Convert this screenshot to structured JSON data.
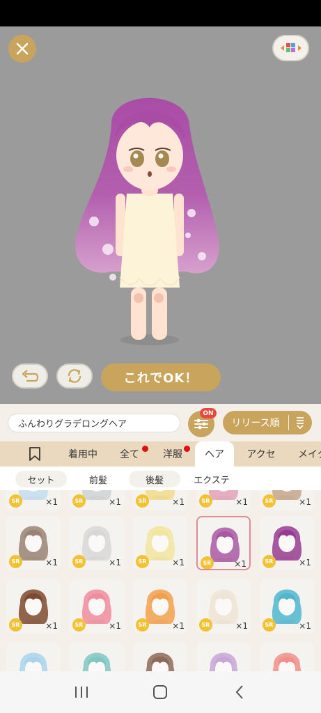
{
  "colors": {
    "accent": "#c9a45c",
    "stage_bg": "#9b9b9b",
    "panel_bg": "#f4efe8",
    "tab_bar": "#ead9bf",
    "badge_red": "#e74a3c"
  },
  "stage": {
    "close_icon": "close-icon",
    "swatch_icon": "color-palette-icon",
    "undo_icon": "undo-icon",
    "refresh_icon": "refresh-icon",
    "ok_label": "これでOK！"
  },
  "panel": {
    "item_name": "ふんわりグラデロングヘア",
    "filter_badge": "ON",
    "sort_label": "リリース順"
  },
  "tabs": [
    {
      "label": "",
      "icon": "bookmark-icon"
    },
    {
      "label": "着用中"
    },
    {
      "label": "全て",
      "dot": true
    },
    {
      "label": "洋服",
      "dot": true
    },
    {
      "label": "ヘア",
      "active": true
    },
    {
      "label": "アクセ"
    },
    {
      "label": "メイク"
    }
  ],
  "subtabs": [
    {
      "label": "セット"
    },
    {
      "label": "前髪"
    },
    {
      "label": "後髪"
    },
    {
      "label": "エクステ"
    }
  ],
  "grid": {
    "rarity": "SR",
    "quantity": "×1",
    "items": [
      {
        "hair": "#b79b82"
      },
      {
        "hair": "#cfd2d3"
      },
      {
        "hair": "#f1da8a"
      },
      {
        "hair": "#b6559e"
      },
      {
        "hair": "#c4a68b"
      },
      {
        "hair": "#9a8372"
      },
      {
        "hair": "#d7d7d7"
      },
      {
        "hair": "#f2e59d"
      },
      {
        "hair": "#a958a4",
        "selected": true
      },
      {
        "hair": "#963b92"
      },
      {
        "hair": "#7c4a2e"
      },
      {
        "hair": "#f18c9c"
      },
      {
        "hair": "#f2a04c"
      },
      {
        "hair": "#eee4d6"
      },
      {
        "hair": "#4fb6cf"
      },
      {
        "hair": "#a9d4ec"
      },
      {
        "hair": "#7fc7c2"
      },
      {
        "hair": "#8c6a55"
      },
      {
        "hair": "#c8a6d8"
      },
      {
        "hair": "#f28f8a"
      }
    ]
  },
  "nav": {
    "recent_icon": "recent-apps-icon",
    "home_icon": "home-icon",
    "back_icon": "back-icon"
  }
}
